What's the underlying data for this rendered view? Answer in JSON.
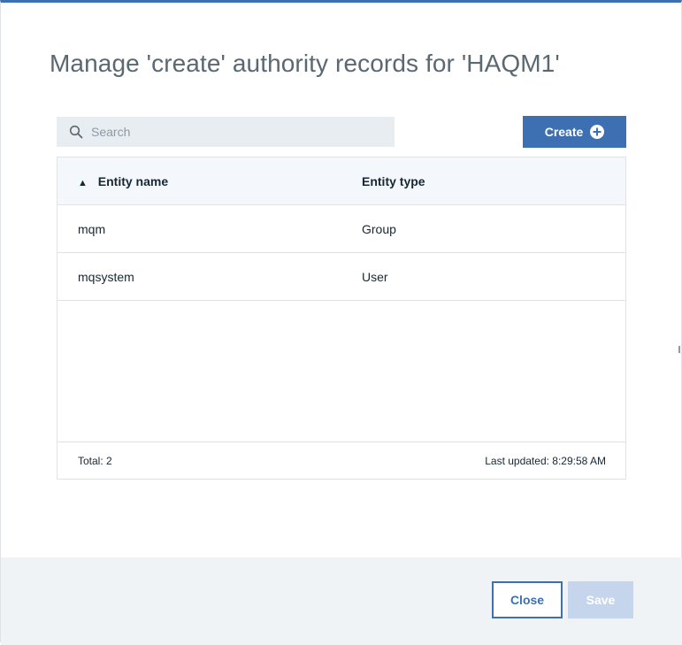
{
  "dialog": {
    "title": "Manage 'create' authority records for 'HAQM1'"
  },
  "search": {
    "placeholder": "Search",
    "value": ""
  },
  "toolbar": {
    "create_label": "Create"
  },
  "table": {
    "columns": [
      "Entity name",
      "Entity type"
    ],
    "sorted_column": "Entity name",
    "sort_direction": "ascending",
    "rows": [
      {
        "name": "mqm",
        "type": "Group"
      },
      {
        "name": "mqsystem",
        "type": "User"
      }
    ],
    "total_label": "Total: 2",
    "last_updated_label": "Last updated: 8:29:58 AM"
  },
  "footer": {
    "close_label": "Close",
    "save_label": "Save"
  },
  "colors": {
    "accent": "#3d70b2",
    "disabled_button": "#c5d6ec",
    "title_text": "#5a6872",
    "search_bg": "#e8edf1",
    "footer_bg": "#f0f3f6"
  },
  "icons": {
    "search": "search-icon",
    "create": "add-circle-icon",
    "sort": "sort-ascending-icon"
  }
}
